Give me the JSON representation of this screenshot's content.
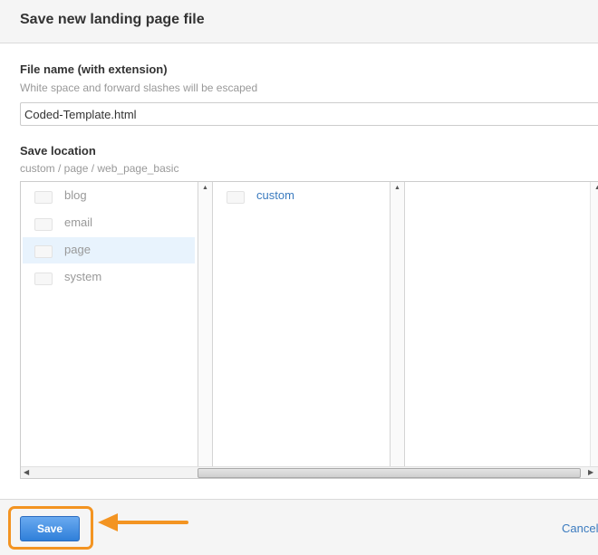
{
  "dialog": {
    "title": "Save new landing page file"
  },
  "file_name": {
    "label": "File name (with extension)",
    "hint": "White space and forward slashes will be escaped",
    "value": "Coded-Template.html"
  },
  "save_location": {
    "label": "Save location",
    "path": "custom / page / web_page_basic"
  },
  "columns": [
    {
      "items": [
        {
          "label": "blog",
          "selected": false,
          "icon": "folder-icon"
        },
        {
          "label": "email",
          "selected": false,
          "icon": "folder-icon"
        },
        {
          "label": "page",
          "selected": true,
          "icon": "folder-icon"
        },
        {
          "label": "system",
          "selected": false,
          "icon": "folder-icon"
        }
      ]
    },
    {
      "items": [
        {
          "label": "custom",
          "selected": false,
          "icon": "folder-icon"
        }
      ]
    },
    {
      "items": []
    }
  ],
  "footer": {
    "save_label": "Save",
    "cancel_label": "Cancel"
  },
  "annotation": {
    "highlight_color": "#f39422"
  }
}
